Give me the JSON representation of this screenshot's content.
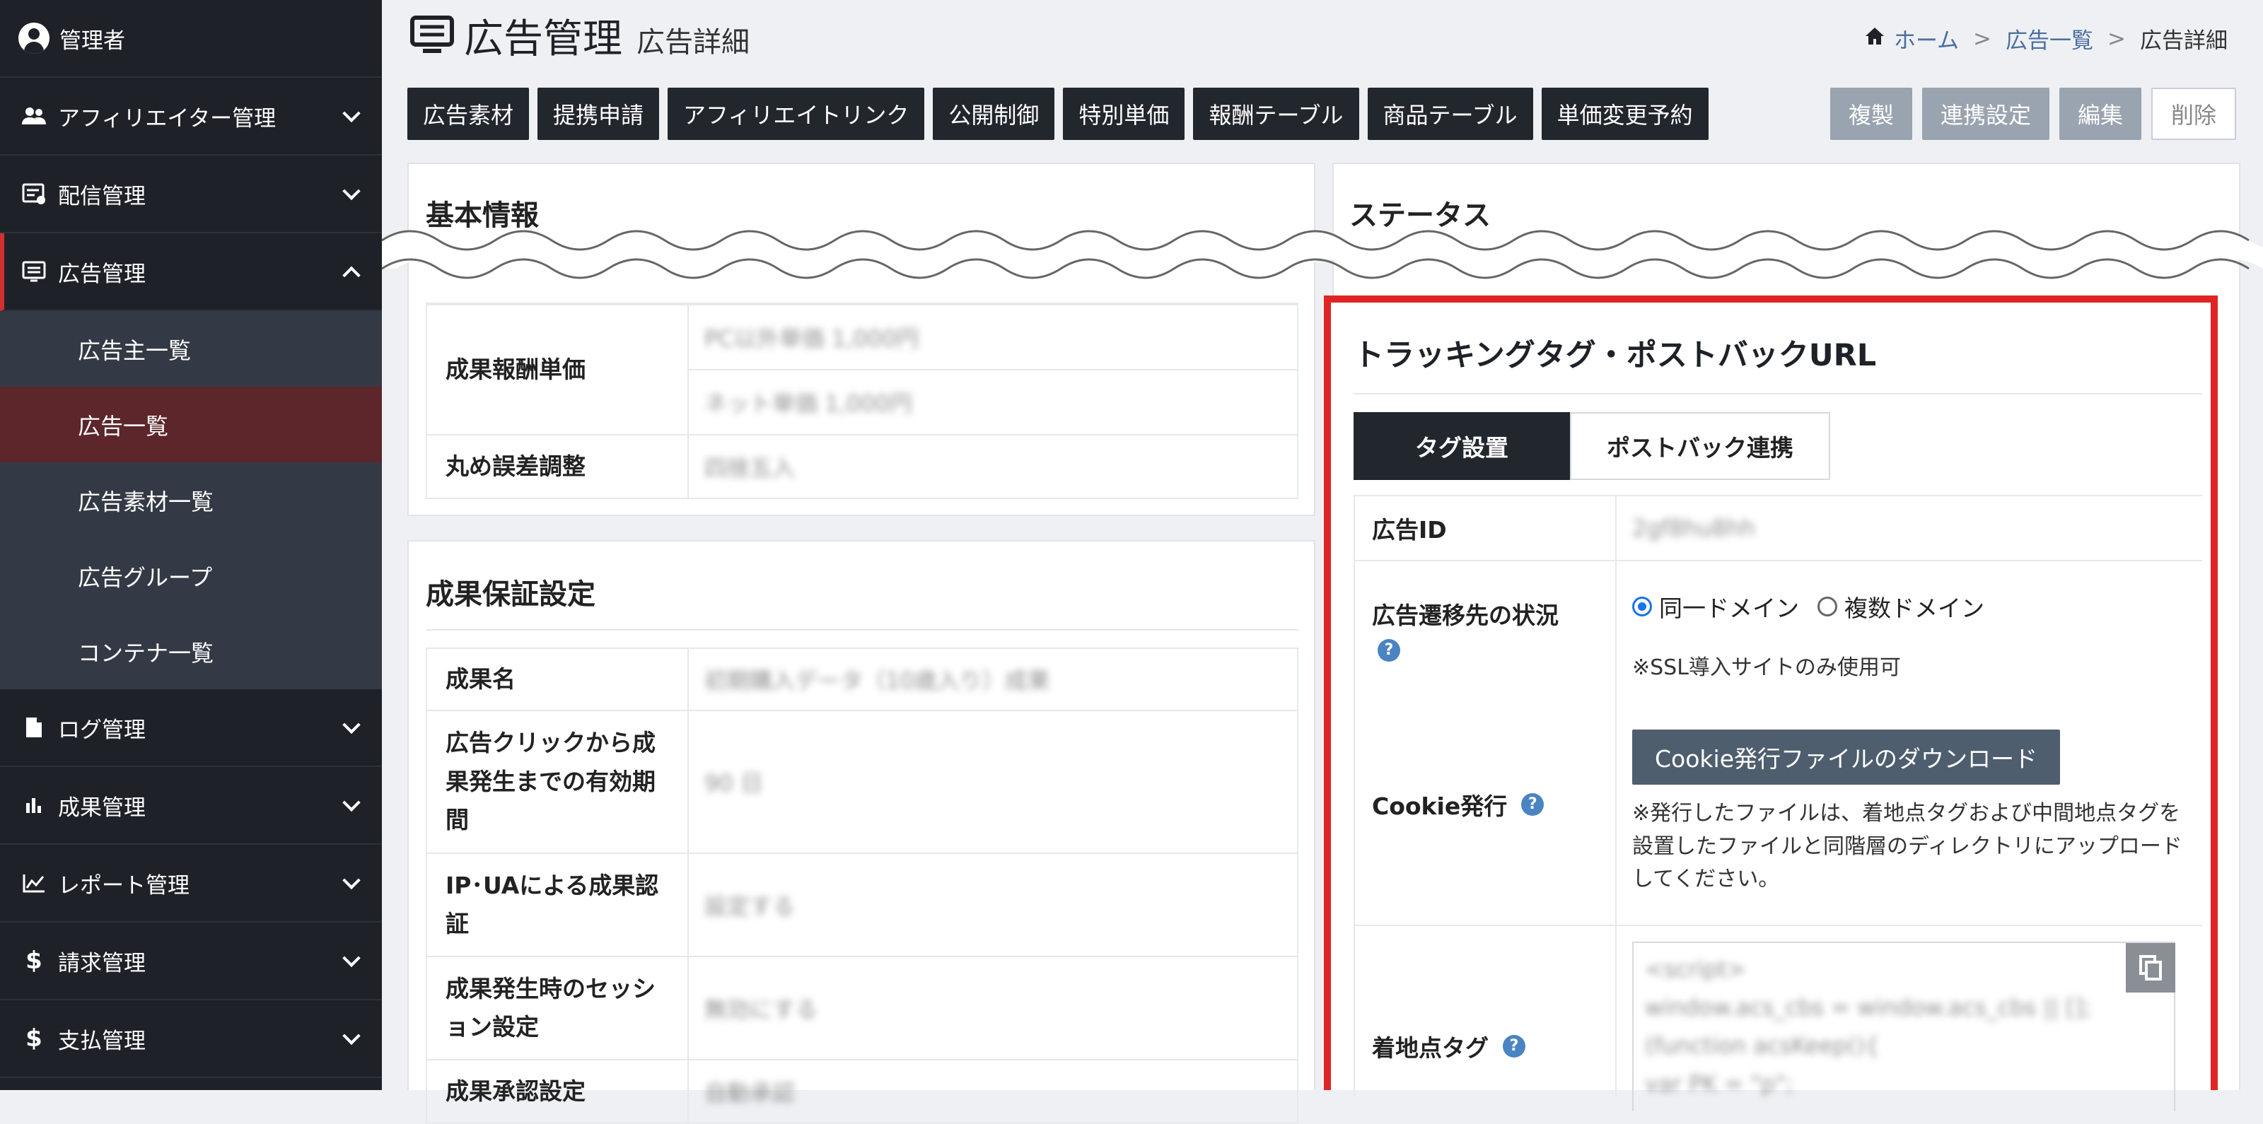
{
  "sidebar": {
    "user": "管理者",
    "items": [
      {
        "label": "アフィリエイター管理",
        "icon": "users-icon"
      },
      {
        "label": "配信管理",
        "icon": "delivery-icon"
      },
      {
        "label": "広告管理",
        "icon": "ad-icon"
      },
      {
        "label": "ログ管理",
        "icon": "document-icon"
      },
      {
        "label": "成果管理",
        "icon": "bar-chart-icon"
      },
      {
        "label": "レポート管理",
        "icon": "line-chart-icon"
      },
      {
        "label": "請求管理",
        "icon": "dollar-icon"
      },
      {
        "label": "支払管理",
        "icon": "dollar-icon"
      }
    ],
    "sub_items": [
      "広告主一覧",
      "広告一覧",
      "広告素材一覧",
      "広告グループ",
      "コンテナ一覧"
    ]
  },
  "header": {
    "title": "広告管理",
    "subtitle": "広告詳細"
  },
  "breadcrumb": {
    "home": "ホーム",
    "sep": ">",
    "list": "広告一覧",
    "current": "広告詳細"
  },
  "tabs": [
    "広告素材",
    "提携申請",
    "アフィリエイトリンク",
    "公開制御",
    "特別単価",
    "報酬テーブル",
    "商品テーブル",
    "単価変更予約"
  ],
  "actions": {
    "copy": "複製",
    "link": "連携設定",
    "edit": "編集",
    "delete": "削除"
  },
  "basic": {
    "title": "基本情報",
    "reward_label": "成果報酬単価",
    "reward_v1": "PC以外単価 1,000円",
    "reward_v2": "ネット単価 1,000円",
    "rounding_label": "丸め誤差調整",
    "rounding_value": "四捨五入"
  },
  "status": {
    "title": "ステータス"
  },
  "guarantee": {
    "title": "成果保証設定",
    "rows": [
      {
        "label": "成果名",
        "value": "初期購入データ（10歳入り）成果"
      },
      {
        "label": "広告クリックから成果発生までの有効期間",
        "value": "90 日"
      },
      {
        "label": "IP･UAによる成果認証",
        "value": "設定する"
      },
      {
        "label": "成果発生時のセッション設定",
        "value": "無効にする"
      },
      {
        "label": "成果承認設定",
        "value": "自動承認"
      }
    ]
  },
  "tracking": {
    "title": "トラッキングタグ・ポストバックURL",
    "tab_tag": "タグ設置",
    "tab_postback": "ポストバック連携",
    "ad_id_label": "広告ID",
    "ad_id_value": "2gf8hu8hh",
    "destination_label": "広告遷移先の状況",
    "radio_same": "同一ドメイン",
    "radio_multi": "複数ドメイン",
    "ssl_note": "※SSL導入サイトのみ使用可",
    "cookie_label": "Cookie発行",
    "download_btn": "Cookie発行ファイルのダウンロード",
    "cookie_note": "※発行したファイルは、着地点タグおよび中間地点タグを設置したファイルと同階層のディレクトリにアップロードしてください。",
    "landing_label": "着地点タグ",
    "code_lines": [
      "<script>",
      "window.acs_cbs = window.acs_cbs || [];",
      "(function acsKeep(){",
      "var PK = \"p\";"
    ]
  }
}
